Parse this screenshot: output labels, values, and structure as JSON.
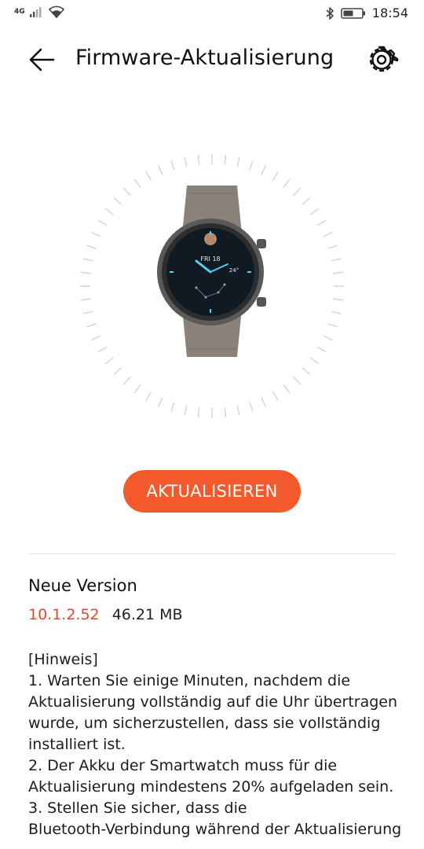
{
  "status_bar": {
    "network": "4G",
    "time": "18:54"
  },
  "header": {
    "title": "Firmware-Aktualisierung"
  },
  "device": {
    "watch_date": "FRI 18",
    "watch_temp": "24°"
  },
  "update_button": {
    "label": "AKTUALISIEREN"
  },
  "version_info": {
    "heading": "Neue Version",
    "version": "10.1.2.52",
    "size": "46.21 MB"
  },
  "notes": [
    "[Hinweis]",
    "1. Warten Sie einige Minuten, nachdem die",
    "Aktualisierung vollständig auf die Uhr übertragen",
    "wurde, um sicherzustellen, dass sie vollständig",
    "installiert ist.",
    "2. Der Akku der Smartwatch muss für die",
    "Aktualisierung mindestens 20% aufgeladen sein.",
    "3. Stellen Sie sicher, dass die",
    "Bluetooth-Verbindung während der Aktualisierung"
  ],
  "colors": {
    "accent": "#f3592a",
    "version_red": "#e8462b"
  }
}
